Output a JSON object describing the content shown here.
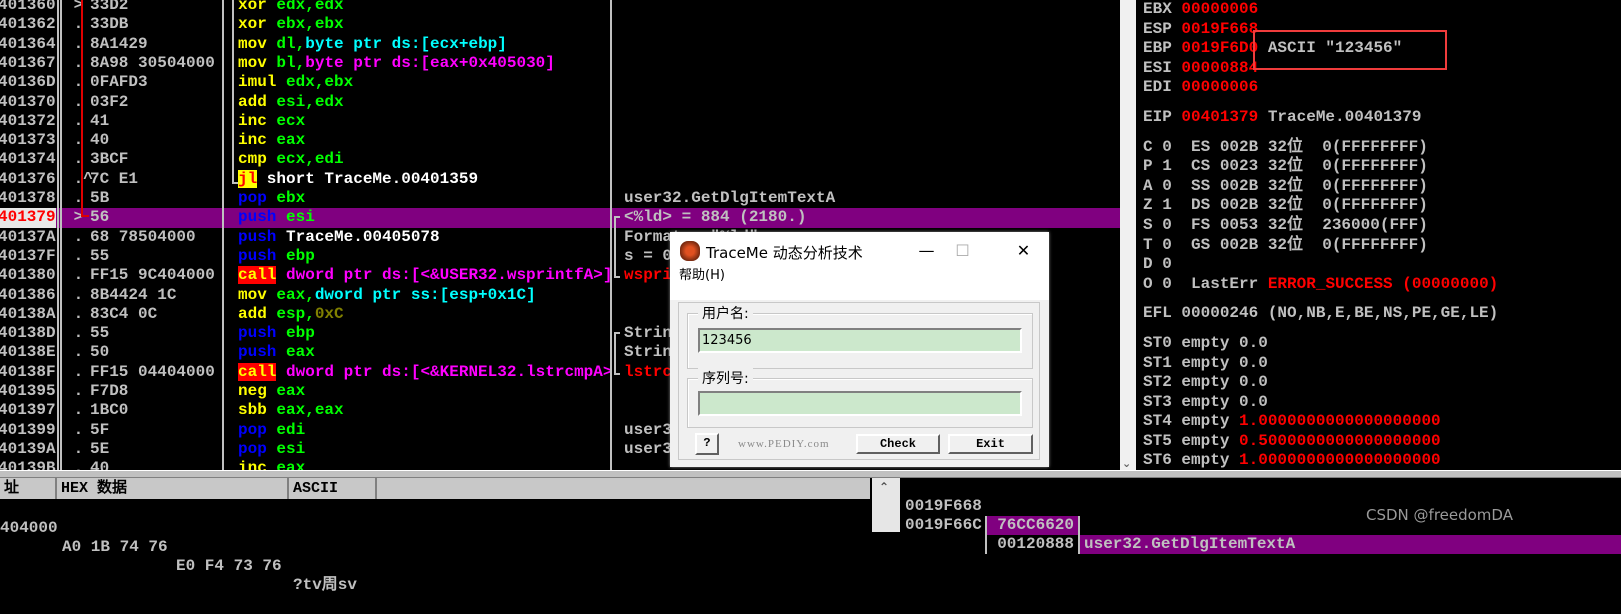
{
  "colors": {
    "mnem": "#ffff00",
    "stackop": "#0000ff",
    "reg": "#00ff00",
    "mem": "#00ffff",
    "mem2": "#ff00ff",
    "white": "#ffffff",
    "imm": "#808000",
    "call_bg": "#ff0000",
    "jmp_bg": "#ffff00",
    "jmp_fg": "#ff0000",
    "red": "#ff0000",
    "gray": "#c0c0c0",
    "highlight": "#800080"
  },
  "disasm": [
    {
      "addr": "401360",
      "mark": " >",
      "hex": "33D2",
      "ins": [
        [
          "xor",
          "mnem"
        ],
        [
          " "
        ],
        [
          "edx,edx",
          "reg"
        ]
      ],
      "cmt": []
    },
    {
      "addr": "401362",
      "mark": " .",
      "hex": "33DB",
      "ins": [
        [
          "xor",
          "mnem"
        ],
        [
          " "
        ],
        [
          "ebx,ebx",
          "reg"
        ]
      ],
      "cmt": []
    },
    {
      "addr": "401364",
      "mark": " .",
      "hex": "8A1429",
      "ins": [
        [
          "mov",
          "mnem"
        ],
        [
          " "
        ],
        [
          "dl,",
          "reg"
        ],
        [
          "byte ptr ds:[ecx+ebp]",
          "mem"
        ]
      ],
      "cmt": []
    },
    {
      "addr": "401367",
      "mark": " .",
      "hex": "8A98 30504000",
      "ins": [
        [
          "mov",
          "mnem"
        ],
        [
          " "
        ],
        [
          "bl,",
          "reg"
        ],
        [
          "byte ptr ds:[eax+0x405030]",
          "mem2"
        ]
      ],
      "cmt": []
    },
    {
      "addr": "40136D",
      "mark": " .",
      "hex": "0FAFD3",
      "ins": [
        [
          "imul",
          "mnem"
        ],
        [
          " "
        ],
        [
          "edx,ebx",
          "reg"
        ]
      ],
      "cmt": []
    },
    {
      "addr": "401370",
      "mark": " .",
      "hex": "03F2",
      "ins": [
        [
          "add",
          "mnem"
        ],
        [
          " "
        ],
        [
          "esi,edx",
          "reg"
        ]
      ],
      "cmt": []
    },
    {
      "addr": "401372",
      "mark": " .",
      "hex": "41",
      "ins": [
        [
          "inc",
          "mnem"
        ],
        [
          " "
        ],
        [
          "ecx",
          "reg"
        ]
      ],
      "cmt": []
    },
    {
      "addr": "401373",
      "mark": " .",
      "hex": "40",
      "ins": [
        [
          "inc",
          "mnem"
        ],
        [
          " "
        ],
        [
          "eax",
          "reg"
        ]
      ],
      "cmt": []
    },
    {
      "addr": "401374",
      "mark": " .",
      "hex": "3BCF",
      "ins": [
        [
          "cmp",
          "mnem"
        ],
        [
          " "
        ],
        [
          "ecx,edi",
          "reg"
        ]
      ],
      "cmt": []
    },
    {
      "addr": "401376",
      "mark": " .^",
      "hex": "7C E1",
      "ins": [
        [
          "jl",
          "jmp"
        ],
        [
          " short TraceMe.00401359",
          "white"
        ]
      ],
      "cmt": []
    },
    {
      "addr": "401378",
      "mark": " .",
      "hex": "5B",
      "ins": [
        [
          "pop",
          "stackop"
        ],
        [
          " "
        ],
        [
          "ebx",
          "reg"
        ]
      ],
      "cmt": [
        [
          "user32.GetDlgItemTextA",
          "gray"
        ]
      ]
    },
    {
      "addr": "401379",
      "mark": " >",
      "hex": "56",
      "sel": true,
      "ins": [
        [
          "push",
          "stackop"
        ],
        [
          " "
        ],
        [
          "esi",
          "reg"
        ]
      ],
      "cmt": [
        [
          "<%ld> = 884 (2180.)",
          "gray"
        ]
      ]
    },
    {
      "addr": "40137A",
      "mark": " .",
      "hex": "68 78504000",
      "ins": [
        [
          "push",
          "stackop"
        ],
        [
          " TraceMe.00405078",
          "white"
        ]
      ],
      "cmt": [
        [
          "Format = \"%ld\"",
          "gray"
        ]
      ]
    },
    {
      "addr": "40137F",
      "mark": " .",
      "hex": "55",
      "ins": [
        [
          "push",
          "stackop"
        ],
        [
          " "
        ],
        [
          "ebp",
          "reg"
        ]
      ],
      "cmt": [
        [
          "s = 0",
          "gray"
        ]
      ]
    },
    {
      "addr": "401380",
      "mark": " .",
      "hex": "FF15 9C404000",
      "ins": [
        [
          "call",
          "call"
        ],
        [
          " "
        ],
        [
          "dword ptr ds:[<&USER32.wsprintfA>]",
          "mem2"
        ]
      ],
      "cmt": [
        [
          "wspri",
          "red"
        ]
      ]
    },
    {
      "addr": "401386",
      "mark": " .",
      "hex": "8B4424 1C",
      "ins": [
        [
          "mov",
          "mnem"
        ],
        [
          " "
        ],
        [
          "eax,",
          "reg"
        ],
        [
          "dword ptr ss:[esp+0x1C]",
          "mem"
        ]
      ],
      "cmt": []
    },
    {
      "addr": "40138A",
      "mark": " .",
      "hex": "83C4 0C",
      "ins": [
        [
          "add",
          "mnem"
        ],
        [
          " "
        ],
        [
          "esp,",
          "reg"
        ],
        [
          "0xC",
          "imm"
        ]
      ],
      "cmt": []
    },
    {
      "addr": "40138D",
      "mark": " .",
      "hex": "55",
      "ins": [
        [
          "push",
          "stackop"
        ],
        [
          " "
        ],
        [
          "ebp",
          "reg"
        ]
      ],
      "cmt": [
        [
          "Strin",
          "gray"
        ]
      ]
    },
    {
      "addr": "40138E",
      "mark": " .",
      "hex": "50",
      "ins": [
        [
          "push",
          "stackop"
        ],
        [
          " "
        ],
        [
          "eax",
          "reg"
        ]
      ],
      "cmt": [
        [
          "Strin",
          "gray"
        ]
      ]
    },
    {
      "addr": "40138F",
      "mark": " .",
      "hex": "FF15 04404000",
      "ins": [
        [
          "call",
          "call"
        ],
        [
          " "
        ],
        [
          "dword ptr ds:[<&KERNEL32.lstrcmpA>",
          "mem2"
        ]
      ],
      "cmt": [
        [
          "lstrc",
          "red"
        ]
      ]
    },
    {
      "addr": "401395",
      "mark": " .",
      "hex": "F7D8",
      "ins": [
        [
          "neg",
          "mnem"
        ],
        [
          " "
        ],
        [
          "eax",
          "reg"
        ]
      ],
      "cmt": []
    },
    {
      "addr": "401397",
      "mark": " .",
      "hex": "1BC0",
      "ins": [
        [
          "sbb",
          "mnem"
        ],
        [
          " "
        ],
        [
          "eax,eax",
          "reg"
        ]
      ],
      "cmt": []
    },
    {
      "addr": "401399",
      "mark": " .",
      "hex": "5F",
      "ins": [
        [
          "pop",
          "stackop"
        ],
        [
          " "
        ],
        [
          "edi",
          "reg"
        ]
      ],
      "cmt": [
        [
          "user3",
          "gray"
        ]
      ]
    },
    {
      "addr": "40139A",
      "mark": " .",
      "hex": "5E",
      "ins": [
        [
          "pop",
          "stackop"
        ],
        [
          " "
        ],
        [
          "esi",
          "reg"
        ]
      ],
      "cmt": [
        [
          "user3",
          "gray"
        ]
      ]
    },
    {
      "addr": "40139B",
      "mark": " .",
      "hex": "40",
      "ins": [
        [
          "inc",
          "mnem"
        ],
        [
          " "
        ],
        [
          "eax",
          "reg"
        ]
      ],
      "cmt": []
    }
  ],
  "registers": [
    {
      "segs": [
        [
          "EBX ",
          "gray"
        ],
        [
          "00000006",
          "red"
        ]
      ]
    },
    {
      "segs": [
        [
          "ESP ",
          "gray"
        ],
        [
          "0019F668",
          "red"
        ]
      ]
    },
    {
      "segs": [
        [
          "EBP ",
          "gray"
        ],
        [
          "0019F6D0",
          "red"
        ],
        [
          " ASCII \"123456\"",
          "gray"
        ]
      ]
    },
    {
      "segs": [
        [
          "ESI ",
          "gray"
        ],
        [
          "00000884",
          "red"
        ]
      ]
    },
    {
      "segs": [
        [
          "EDI ",
          "gray"
        ],
        [
          "00000006",
          "red"
        ]
      ]
    },
    {
      "gap": true,
      "segs": [
        [
          "EIP ",
          "gray"
        ],
        [
          "00401379",
          "red"
        ],
        [
          " TraceMe.00401379",
          "gray"
        ]
      ]
    },
    {
      "gap": true,
      "segs": [
        [
          "C 0  ES 002B 32位  0(FFFFFFFF)",
          "gray"
        ]
      ]
    },
    {
      "segs": [
        [
          "P 1  CS 0023 32位  0(FFFFFFFF)",
          "gray"
        ]
      ]
    },
    {
      "segs": [
        [
          "A 0  SS 002B 32位  0(FFFFFFFF)",
          "gray"
        ]
      ]
    },
    {
      "segs": [
        [
          "Z 1  DS 002B 32位  0(FFFFFFFF)",
          "gray"
        ]
      ]
    },
    {
      "segs": [
        [
          "S 0  FS 0053 32位  236000(FFF)",
          "gray"
        ]
      ]
    },
    {
      "segs": [
        [
          "T 0  GS 002B 32位  0(FFFFFFFF)",
          "gray"
        ]
      ]
    },
    {
      "segs": [
        [
          "D 0",
          "gray"
        ]
      ]
    },
    {
      "segs": [
        [
          "O 0  LastErr ",
          "gray"
        ],
        [
          "ERROR_SUCCESS (00000000)",
          "red"
        ]
      ]
    },
    {
      "gap": true,
      "segs": [
        [
          "EFL 00000246 (NO,NB,E,BE,NS,PE,GE,LE)",
          "gray"
        ]
      ]
    },
    {
      "gap": true,
      "segs": [
        [
          "ST0 empty 0.0",
          "gray"
        ]
      ]
    },
    {
      "segs": [
        [
          "ST1 empty 0.0",
          "gray"
        ]
      ]
    },
    {
      "segs": [
        [
          "ST2 empty 0.0",
          "gray"
        ]
      ]
    },
    {
      "segs": [
        [
          "ST3 empty 0.0",
          "gray"
        ]
      ]
    },
    {
      "segs": [
        [
          "ST4 empty ",
          "gray"
        ],
        [
          "1.0000000000000000000",
          "red"
        ]
      ]
    },
    {
      "segs": [
        [
          "ST5 empty ",
          "gray"
        ],
        [
          "0.5000000000000000000",
          "red"
        ]
      ]
    },
    {
      "segs": [
        [
          "ST6 empty ",
          "gray"
        ],
        [
          "1.0000000000000000000",
          "red"
        ]
      ]
    },
    {
      "segs": [
        [
          "ST7 empty 0.0",
          "gray"
        ]
      ]
    }
  ],
  "dump": {
    "headers": [
      "址",
      "HEX 数据",
      "ASCII"
    ],
    "row": {
      "addr": "404000",
      "hex1": "A0 1B 74 76",
      "hex2": "E0 F4 73 76",
      "ascii": "?tv周sv"
    }
  },
  "stack": [
    {
      "addr": "0019F668",
      "value": "76CC6620",
      "comment": "user32.GetDlgItemTextA",
      "sel": true
    },
    {
      "addr": "0019F66C",
      "value": "00120888",
      "comment": ""
    }
  ],
  "dialog": {
    "title": "TraceMe 动态分析技术",
    "menu": "帮助(H)",
    "username_label": "用户名:",
    "username_value": "123456",
    "serial_label": "序列号:",
    "serial_value": "",
    "help_button": "?",
    "site": "www.PEDIY.com",
    "check_button": "Check",
    "exit_button": "Exit",
    "minimize": "—",
    "maximize": "☐",
    "close": "✕"
  },
  "watermark": "CSDN @freedomDA"
}
